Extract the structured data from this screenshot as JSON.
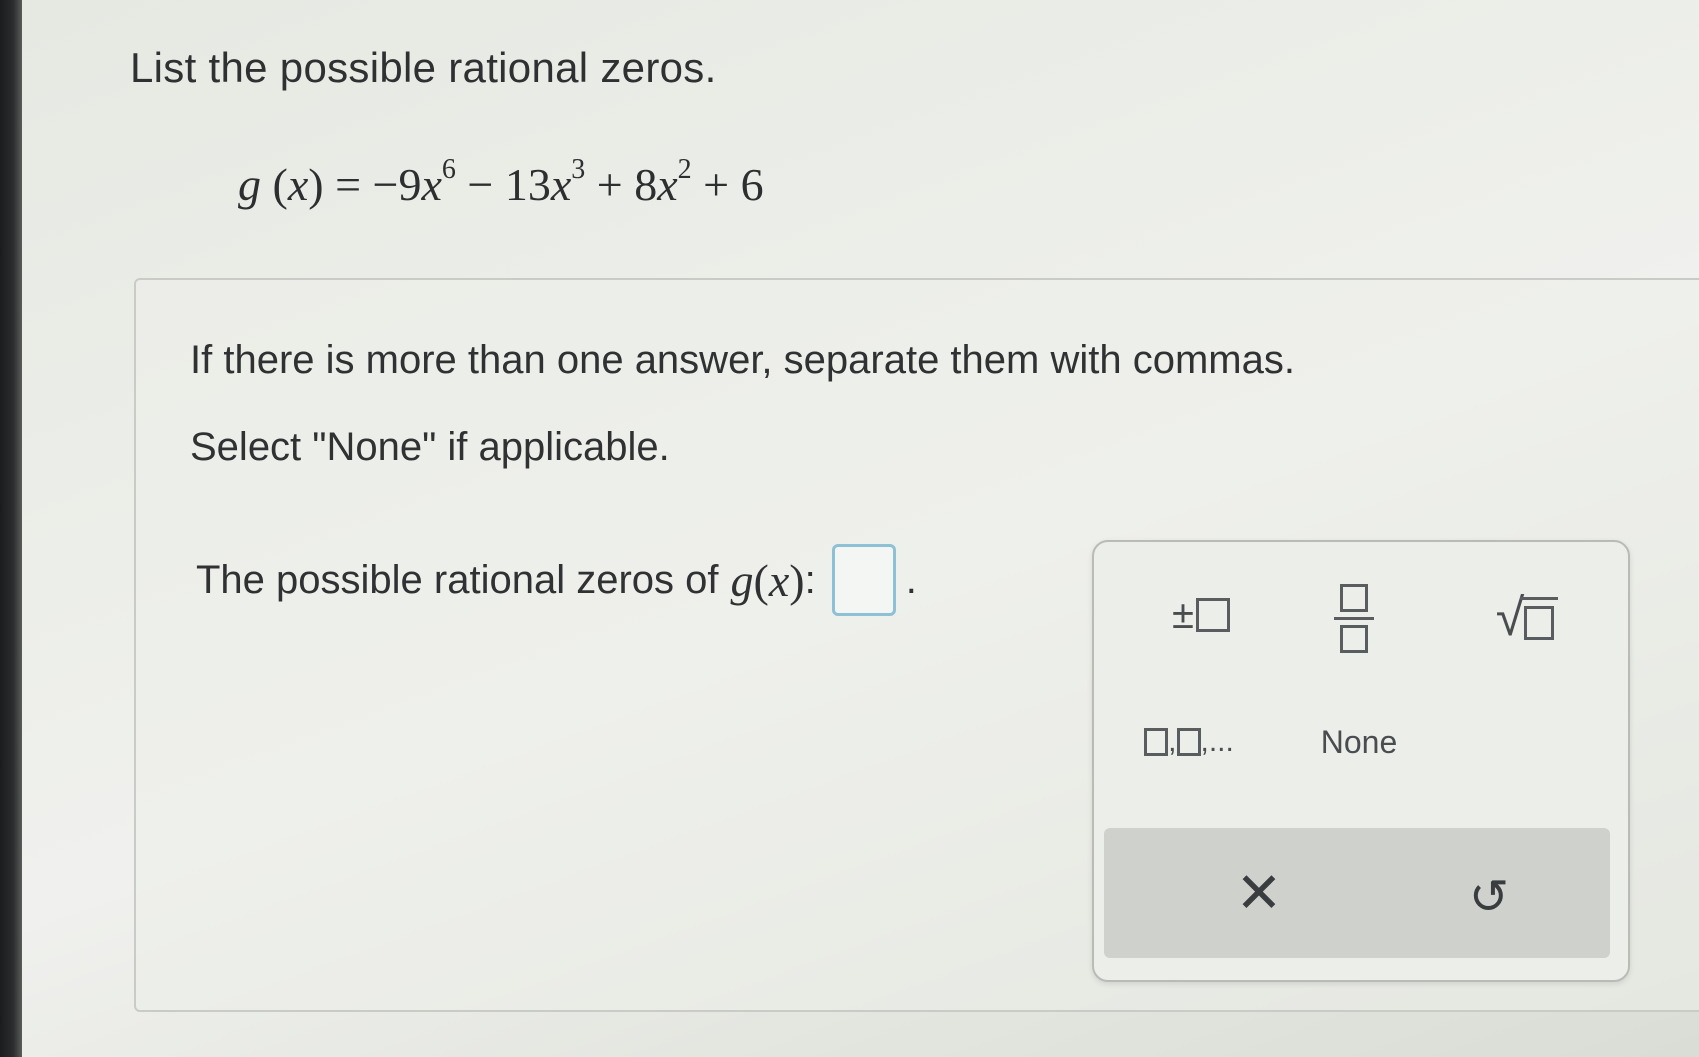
{
  "question": {
    "title": "List the possible rational zeros."
  },
  "equation": {
    "fn_name": "g",
    "fn_var": "x",
    "equals": "=",
    "minus_sign": "−",
    "term1_coef": "9",
    "term1_var": "x",
    "term1_exp": "6",
    "op2": "−",
    "term2_coef": "13",
    "term2_var": "x",
    "term2_exp": "3",
    "op3": "+",
    "term3_coef": "8",
    "term3_var": "x",
    "term3_exp": "2",
    "op4": "+",
    "constant": "6"
  },
  "instructions": {
    "line1": "If there is more than one answer, separate them with commas.",
    "line2": "Select \"None\" if applicable."
  },
  "prompt": {
    "text": "The possible rational zeros of",
    "fn_name": "g",
    "fn_var": "x",
    "colon": ":",
    "period": "."
  },
  "palette": {
    "plus_minus_symbol": "±",
    "sqrt_symbol": "√",
    "list_separator": ",",
    "list_ellipsis": ",...",
    "none_label": "None",
    "clear_symbol": "✕",
    "undo_symbol": "↺"
  },
  "icons": {
    "plus_minus": "plus-minus-icon",
    "fraction": "fraction-icon",
    "sqrt": "square-root-icon",
    "list": "list-icon",
    "clear": "close-icon",
    "undo": "undo-icon"
  },
  "colors": {
    "input_border": "#8fc1d6",
    "action_bar": "#cfd1cd"
  }
}
